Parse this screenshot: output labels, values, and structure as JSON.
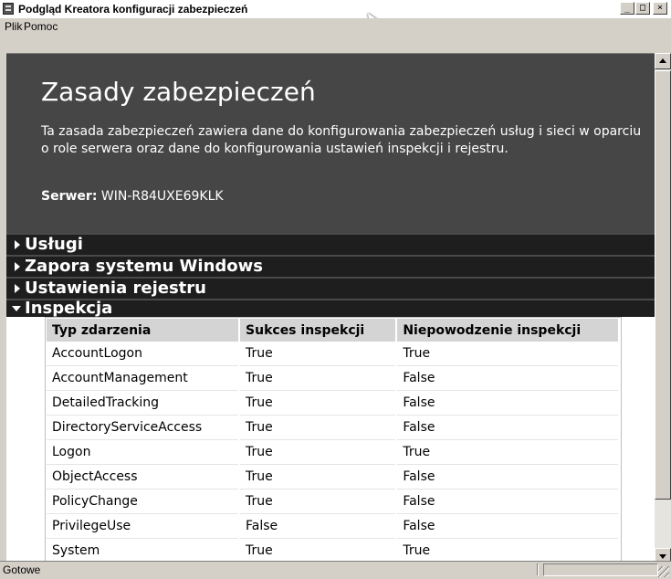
{
  "window": {
    "title": "Podgląd Kreatora konfiguracji zabezpieczeń",
    "controls": {
      "minimize": "_",
      "maximize": "□",
      "close": "×"
    }
  },
  "menu": {
    "items": [
      "Plik",
      "Pomoc"
    ]
  },
  "header": {
    "title": "Zasady zabezpieczeń",
    "description": "Ta zasada zabezpieczeń zawiera dane do konfigurowania zabezpieczeń usług i sieci w oparciu o role serwera oraz dane do konfigurowania ustawień inspekcji i rejestru.",
    "server_label": "Serwer:",
    "server_value": "WIN-R84UXE69KLK"
  },
  "sections": [
    {
      "label": "Usługi",
      "expanded": false
    },
    {
      "label": "Zapora systemu Windows",
      "expanded": false
    },
    {
      "label": "Ustawienia rejestru",
      "expanded": false
    },
    {
      "label": "Inspekcja",
      "expanded": true
    }
  ],
  "audit_table": {
    "headers": [
      "Typ zdarzenia",
      "Sukces inspekcji",
      "Niepowodzenie inspekcji"
    ],
    "rows": [
      [
        "AccountLogon",
        "True",
        "True"
      ],
      [
        "AccountManagement",
        "True",
        "False"
      ],
      [
        "DetailedTracking",
        "True",
        "False"
      ],
      [
        "DirectoryServiceAccess",
        "True",
        "False"
      ],
      [
        "Logon",
        "True",
        "True"
      ],
      [
        "ObjectAccess",
        "True",
        "False"
      ],
      [
        "PolicyChange",
        "True",
        "False"
      ],
      [
        "PrivilegeUse",
        "False",
        "False"
      ],
      [
        "System",
        "True",
        "True"
      ]
    ]
  },
  "statusbar": {
    "text": "Gotowe"
  },
  "colors": {
    "header_bg": "#464646",
    "section_bg": "#1e1e1e",
    "table_header_bg": "#d4d4d4"
  }
}
